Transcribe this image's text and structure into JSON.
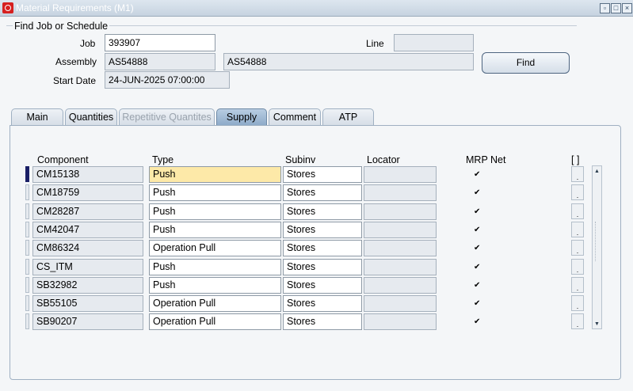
{
  "window": {
    "title": "Material Requirements (M1)",
    "controls": {
      "minimize": "▫",
      "maximize": "□",
      "close": "×"
    }
  },
  "find": {
    "group_label": "Find Job or Schedule",
    "job_label": "Job",
    "job_value": "393907",
    "line_label": "Line",
    "line_value": "",
    "assembly_label": "Assembly",
    "assembly_value": "AS54888",
    "assembly_desc": "AS54888",
    "start_date_label": "Start Date",
    "start_date_value": "24-JUN-2025 07:00:00",
    "find_button": "Find"
  },
  "tabs": [
    {
      "label": "Main",
      "state": "normal"
    },
    {
      "label": "Quantities",
      "state": "normal"
    },
    {
      "label": "Repetitive Quantites",
      "state": "disabled"
    },
    {
      "label": "Supply",
      "state": "active"
    },
    {
      "label": "Comment",
      "state": "normal"
    },
    {
      "label": "ATP",
      "state": "normal"
    }
  ],
  "table": {
    "headers": {
      "component": "Component",
      "type": "Type",
      "subinv": "Subinv",
      "locator": "Locator",
      "mrp_net": "MRP Net",
      "flex": "[ ]"
    },
    "check_glyph": "✔",
    "flex_glyph": ".",
    "rows": [
      {
        "component": "CM15138",
        "type": "Push",
        "subinv": "Stores",
        "locator": "",
        "mrp_net": true
      },
      {
        "component": "CM18759",
        "type": "Push",
        "subinv": "Stores",
        "locator": "",
        "mrp_net": true
      },
      {
        "component": "CM28287",
        "type": "Push",
        "subinv": "Stores",
        "locator": "",
        "mrp_net": true
      },
      {
        "component": "CM42047",
        "type": "Push",
        "subinv": "Stores",
        "locator": "",
        "mrp_net": true
      },
      {
        "component": "CM86324",
        "type": "Operation Pull",
        "subinv": "Stores",
        "locator": "",
        "mrp_net": true
      },
      {
        "component": "CS_ITM",
        "type": "Push",
        "subinv": "Stores",
        "locator": "",
        "mrp_net": true
      },
      {
        "component": "SB32982",
        "type": "Push",
        "subinv": "Stores",
        "locator": "",
        "mrp_net": true
      },
      {
        "component": "SB55105",
        "type": "Operation Pull",
        "subinv": "Stores",
        "locator": "",
        "mrp_net": true
      },
      {
        "component": "SB90207",
        "type": "Operation Pull",
        "subinv": "Stores",
        "locator": "",
        "mrp_net": true
      }
    ],
    "scroll_up": "▲",
    "scroll_down": "▼"
  }
}
